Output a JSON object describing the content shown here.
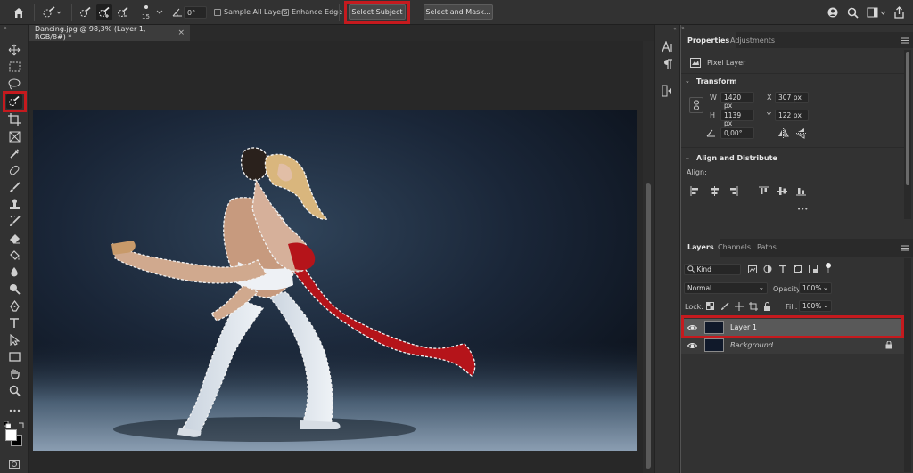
{
  "options_bar": {
    "brush_size": "15",
    "angle": "0°",
    "sample_all_layers": "Sample All Layers",
    "enhance_edge": "Enhance Edge",
    "select_subject": "Select Subject",
    "select_and_mask": "Select and Mask..."
  },
  "document": {
    "tab_title": "Dancing.jpg @ 98,3% (Layer 1, RGB/8#) *",
    "close_glyph": "×"
  },
  "properties_panel": {
    "tabs": [
      "Properties",
      "Adjustments"
    ],
    "pixel_layer": "Pixel Layer",
    "transform": {
      "title": "Transform",
      "w_label": "W",
      "w_value": "1420 px",
      "h_label": "H",
      "h_value": "1139 px",
      "x_label": "X",
      "x_value": "307 px",
      "y_label": "Y",
      "y_value": "122 px",
      "angle_value": "0,00°"
    },
    "align": {
      "title": "Align and Distribute",
      "align_label": "Align:",
      "more": "•••"
    }
  },
  "layers_panel": {
    "tabs": [
      "Layers",
      "Channels",
      "Paths"
    ],
    "kind_filter": "Kind",
    "blend_mode": "Normal",
    "opacity_label": "Opacity:",
    "opacity_value": "100%",
    "lock_label": "Lock:",
    "fill_label": "Fill:",
    "fill_value": "100%",
    "layers": [
      {
        "name": "Layer 1",
        "selected": true
      },
      {
        "name": "Background",
        "selected": false,
        "locked": true
      }
    ]
  },
  "colors": {
    "highlight": "#c51a1e",
    "selection_red": "#b5141a"
  }
}
